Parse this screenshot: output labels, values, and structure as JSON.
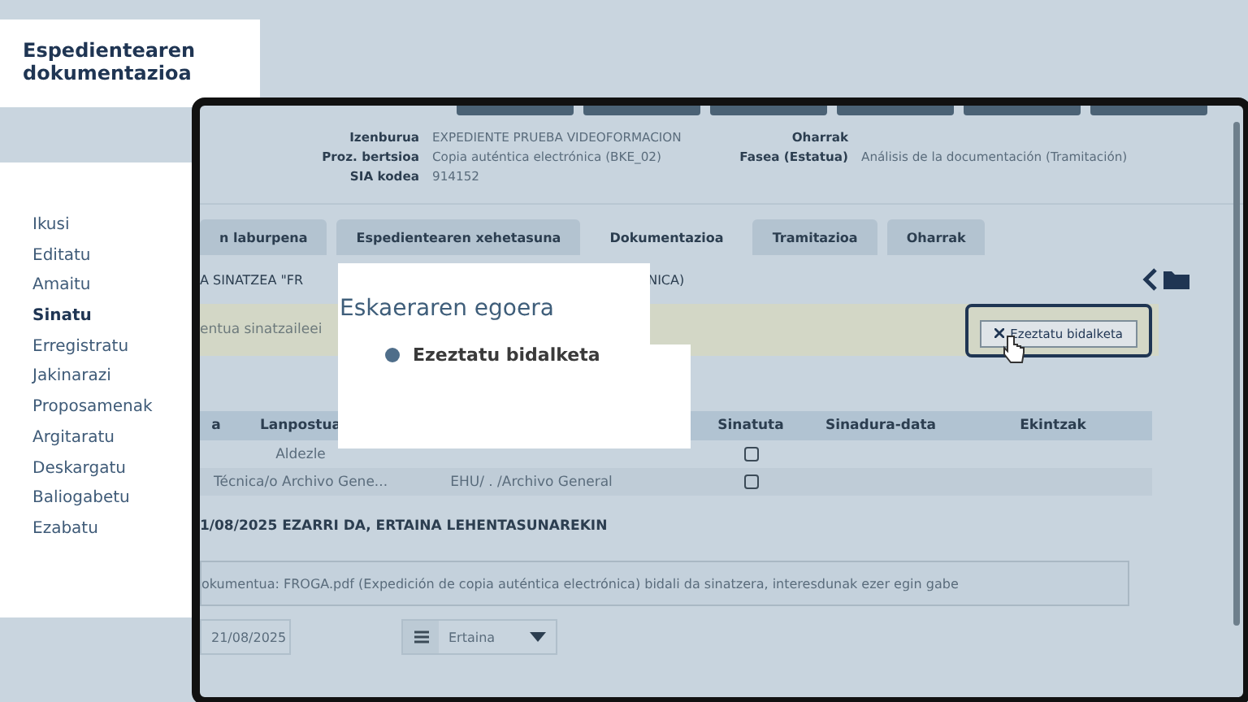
{
  "title_card": {
    "title": "Espedientearen dokumentazioa"
  },
  "sidebar": {
    "items": [
      {
        "label": "Ikusi",
        "selected": false
      },
      {
        "label": "Editatu",
        "selected": false
      },
      {
        "label": "Amaitu",
        "selected": false
      },
      {
        "label": "Sinatu",
        "selected": true
      },
      {
        "label": "Erregistratu",
        "selected": false
      },
      {
        "label": "Jakinarazi",
        "selected": false
      },
      {
        "label": "Proposamenak",
        "selected": false
      },
      {
        "label": "Argitaratu",
        "selected": false
      },
      {
        "label": "Deskargatu",
        "selected": false
      },
      {
        "label": "Baliogabetu",
        "selected": false
      },
      {
        "label": "Ezabatu",
        "selected": false
      }
    ]
  },
  "window": {
    "info_left": [
      {
        "label": "Izenburua",
        "value": "EXPEDIENTE PRUEBA VIDEOFORMACION"
      },
      {
        "label": "Proz. bertsioa",
        "value": "Copia auténtica electrónica (BKE_02)"
      },
      {
        "label": "SIA kodea",
        "value": "914152"
      }
    ],
    "info_right": [
      {
        "label": "Oharrak"
      },
      {
        "label": "Fasea (Estatua)",
        "value": "Análisis de la documentación (Tramitación)"
      }
    ],
    "tabs": [
      {
        "label": "n laburpena",
        "selected": false
      },
      {
        "label": "Espedientearen xehetasuna",
        "selected": false
      },
      {
        "label": "Dokumentazioa",
        "selected": true
      },
      {
        "label": "Tramitazioa",
        "selected": false
      },
      {
        "label": "Oharrak",
        "selected": false
      }
    ],
    "heading_parts": [
      "A SINATZEA \"FR",
      "NICA)"
    ],
    "notice": "entua sinatzaileei",
    "cancel_button": "Ezeztatu bidalketa",
    "table": {
      "columns": [
        "a",
        "Lanpostua",
        "Sinatuta",
        "Sinadura-data",
        "Ekintzak"
      ],
      "rows": [
        {
          "cells": [
            null,
            "Aldezle",
            null
          ],
          "checked": false
        },
        {
          "cells": [
            null,
            "Técnica/o Archivo Gene...",
            "EHU/ . /Archivo General"
          ],
          "checked": false
        }
      ]
    },
    "status_line": "1/08/2025 EZARRI DA, ERTAINA LEHENTASUNAREKIN",
    "message": "okumentua: FROGA.pdf (Expedición de copia auténtica electrónica) bidali da sinatzera, interesdunak ezer egin gabe",
    "date_field": "21/08/2025",
    "priority_select": "Ertaina"
  },
  "popup": {
    "title": "Eskaeraren egoera",
    "status": "Ezeztatu bidalketa"
  }
}
